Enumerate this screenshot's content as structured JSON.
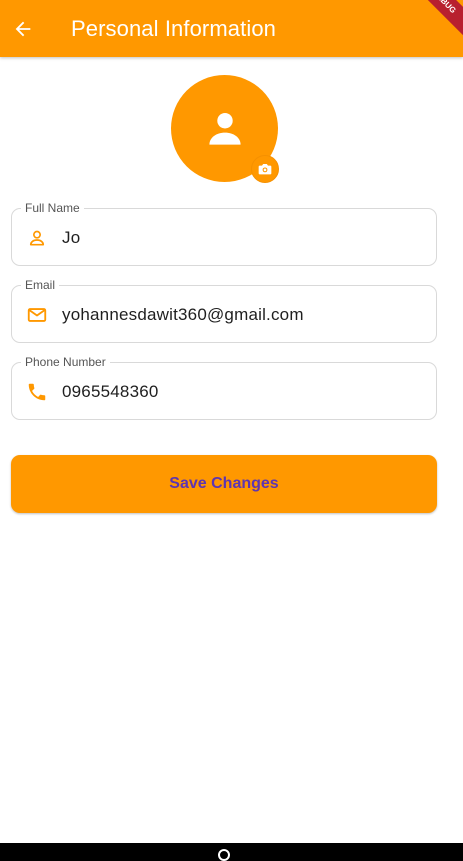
{
  "appbar": {
    "title": "Personal Information",
    "back_icon": "arrow-left-icon",
    "background": "#ff9800"
  },
  "debug_banner": {
    "label": "DEBUG"
  },
  "avatar": {
    "icon": "person-icon",
    "edit_icon": "camera-icon",
    "background": "#ff9800"
  },
  "fields": [
    {
      "label": "Full Name",
      "value": "Jo",
      "icon": "person-outline-icon"
    },
    {
      "label": "Email",
      "value": "yohannesdawit360@gmail.com",
      "icon": "mail-icon"
    },
    {
      "label": "Phone Number",
      "value": "0965548360",
      "icon": "phone-icon"
    }
  ],
  "save_button": {
    "label": "Save Changes",
    "background": "#ff9800",
    "text_color": "#5e35b1"
  }
}
